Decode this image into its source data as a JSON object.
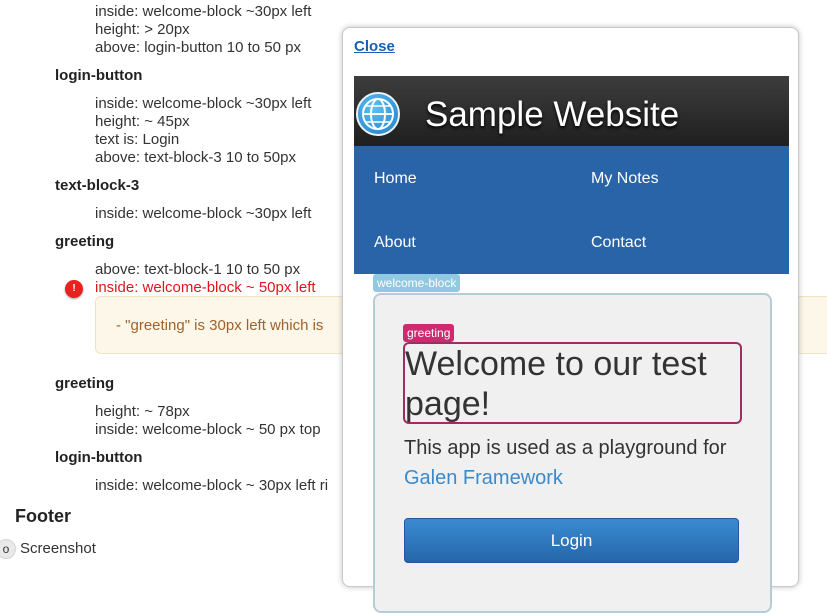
{
  "spec_report": {
    "lines": [
      "inside: welcome-block ~30px left",
      "height: > 20px",
      "above: login-button 10 to 50 px",
      "login-button",
      "inside: welcome-block ~30px left",
      "height: ~ 45px",
      "text is: Login",
      "above: text-block-3 10 to 50px",
      "text-block-3",
      "inside: welcome-block ~30px left",
      "greeting",
      "above: text-block-1 10 to 50 px",
      "inside: welcome-block ~ 50px left",
      "greeting",
      "height: ~ 78px",
      "inside: welcome-block ~ 50 px top",
      "login-button",
      "inside: welcome-block ~ 30px left ri"
    ],
    "error_icon": "!",
    "error_message": "- \"greeting\" is 30px left which is",
    "footer_title": "Footer",
    "screenshot_toggle": "o",
    "screenshot_label": "Screenshot"
  },
  "popup": {
    "close_label": "Close",
    "site": {
      "title": "Sample Website",
      "nav": [
        "Home",
        "My Notes",
        "About",
        "Contact"
      ],
      "welcome_label": "welcome-block",
      "greeting_label": "greeting",
      "greeting": "Welcome to our test page!",
      "intro": "This app is used as a playground for",
      "intro_link": "Galen Framework",
      "login": "Login"
    }
  },
  "colors": {
    "error": "#e0161b",
    "nav_bg": "#2a64a8",
    "greeting_highlight": "#cf2a6f",
    "welcome_highlight": "#93c9e0",
    "link": "#1a5fb4"
  }
}
